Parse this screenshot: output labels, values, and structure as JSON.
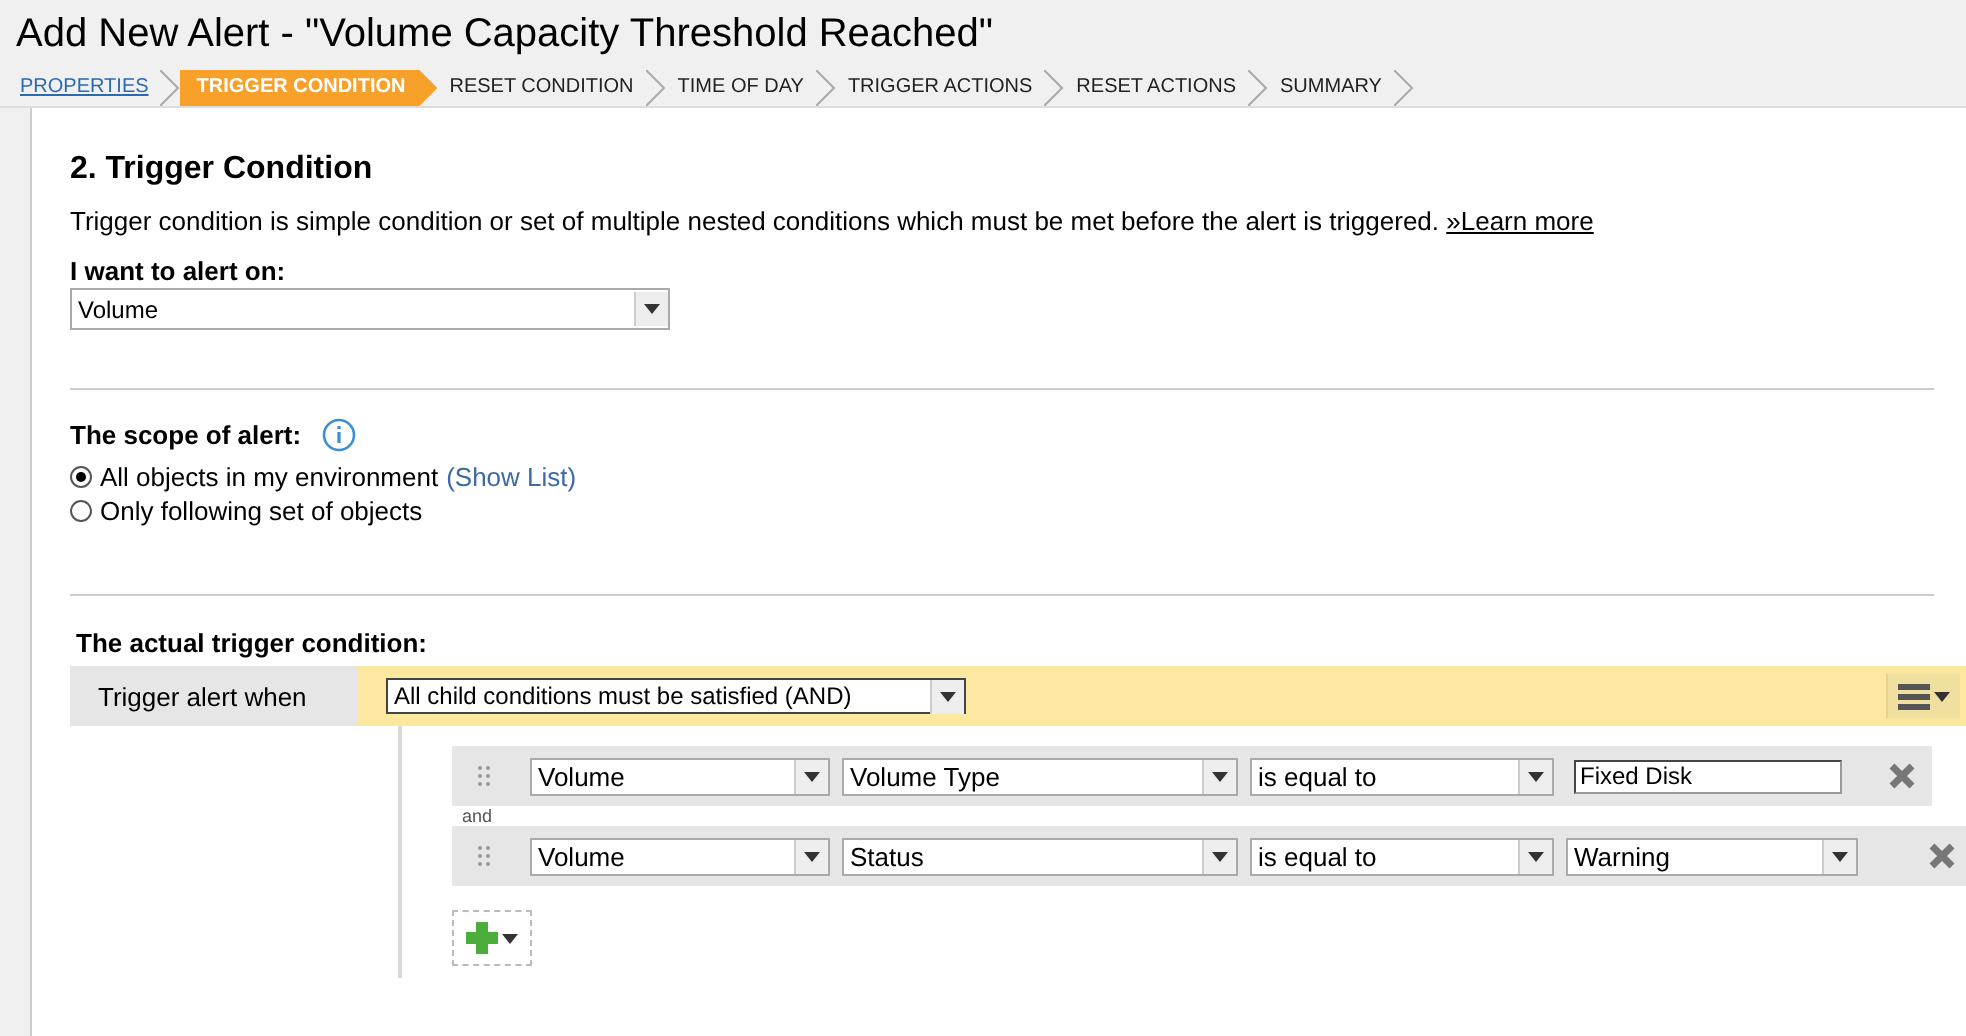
{
  "window": {
    "title": "Add New Alert - \"Volume Capacity Threshold Reached\""
  },
  "steps": [
    {
      "label": "PROPERTIES",
      "selected": false,
      "completed": true
    },
    {
      "label": "TRIGGER CONDITION",
      "selected": true,
      "completed": false
    },
    {
      "label": "RESET CONDITION",
      "selected": false,
      "completed": false
    },
    {
      "label": "TIME OF DAY",
      "selected": false,
      "completed": false
    },
    {
      "label": "TRIGGER ACTIONS",
      "selected": false,
      "completed": false
    },
    {
      "label": "RESET ACTIONS",
      "selected": false,
      "completed": false
    },
    {
      "label": "SUMMARY",
      "selected": false,
      "completed": false
    }
  ],
  "heading": "2. Trigger Condition",
  "description": "Trigger condition is simple condition or set of multiple nested conditions which must be met before the alert is triggered.",
  "learn_more": "»Learn more",
  "alert_on": {
    "label": "I want to alert on:",
    "value": "Volume"
  },
  "scope": {
    "label": "The scope of alert:",
    "options": [
      {
        "label": "All objects in my environment",
        "link": "(Show List)",
        "selected": true
      },
      {
        "label": "Only following set of objects",
        "selected": false
      }
    ]
  },
  "trigger": {
    "label": "The actual trigger condition:",
    "when": "Trigger alert when",
    "group_value": "All child conditions must be satisfied (AND)",
    "joiner": "and",
    "conditions": [
      {
        "field": "Volume",
        "property": "Volume Type",
        "operator": "is equal to",
        "value": {
          "kind": "input",
          "text": "Fixed Disk"
        }
      },
      {
        "field": "Volume",
        "property": "Status",
        "operator": "is equal to",
        "value": {
          "kind": "select",
          "text": "Warning"
        }
      }
    ]
  }
}
